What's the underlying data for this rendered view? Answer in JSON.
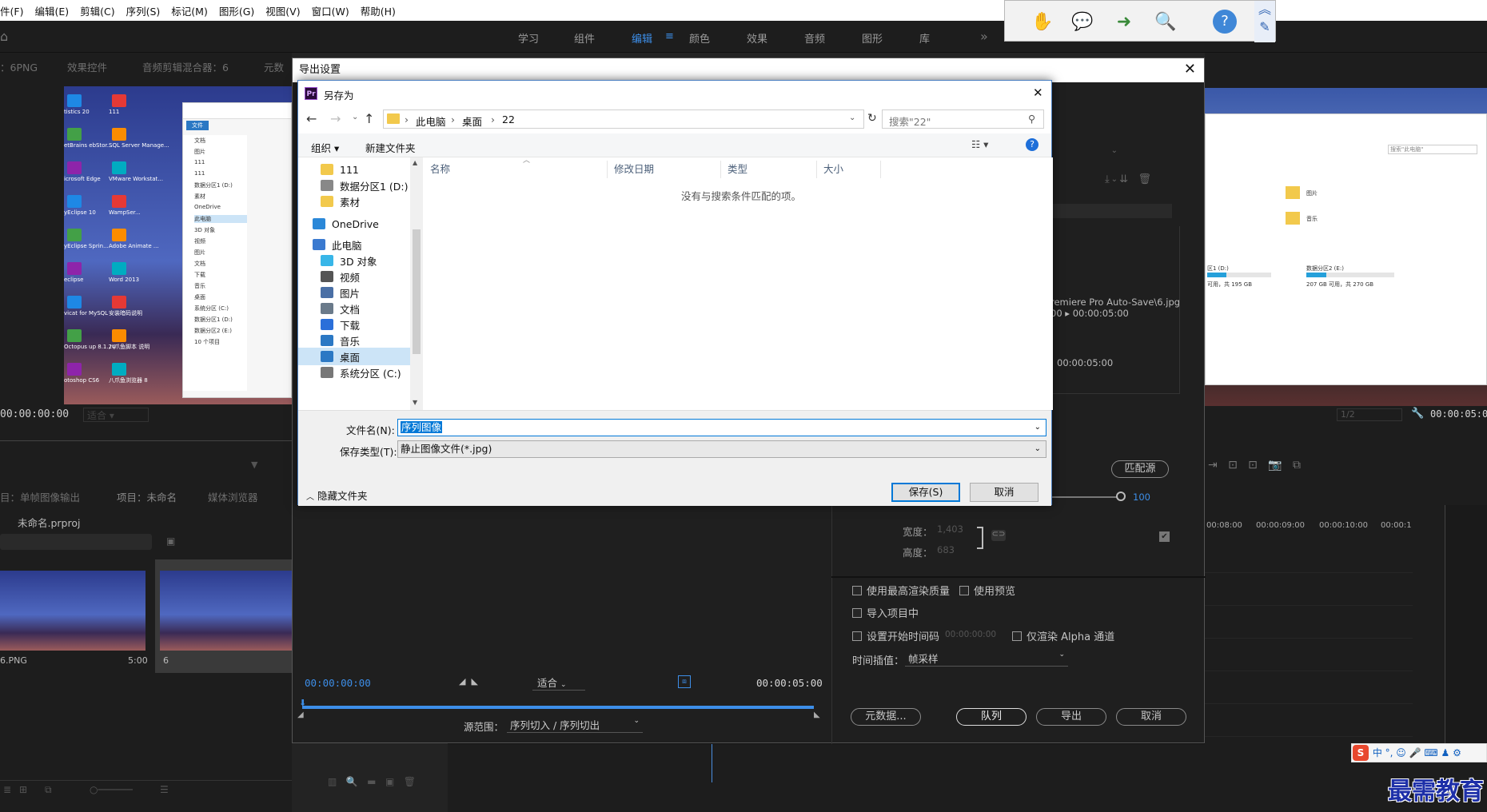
{
  "menubar": [
    "件(F)",
    "编辑(E)",
    "剪辑(C)",
    "序列(S)",
    "标记(M)",
    "图形(G)",
    "视图(V)",
    "窗口(W)",
    "帮助(H)"
  ],
  "workspaces": [
    "学习",
    "组件",
    "编辑",
    "颜色",
    "效果",
    "音频",
    "图形",
    "库"
  ],
  "left_panel": {
    "tabs": [
      "：6PNG",
      "效果控件",
      "音频剪辑混合器：6",
      "元数"
    ],
    "timecode": "00:00:00:00",
    "zoom": "适合",
    "project_tabs": [
      "目：单帧图像输出",
      "项目：未命名",
      "媒体浏览器"
    ],
    "project_file": "未命名.prproj",
    "clips": [
      {
        "name": "6.PNG",
        "dur": "5:00"
      },
      {
        "name": "6",
        "dur": ""
      }
    ]
  },
  "desktop_icons": [
    "tistics 20",
    "111",
    "etBrains ebStor...",
    "SQL Server Manage...",
    "icrosoft Edge",
    "VMware Workstat...",
    "yEclipse 10",
    "WampSer...",
    "yEclipse Sprin...",
    "Adobe Animate ...",
    "eclipse",
    "Word 2013",
    "vicat for MySQL",
    "安装暗码说明",
    "Octopus up 8.1.24",
    "八爪鱼脚本 说明",
    "otoshop CS6",
    "八爪鱼浏览器 8"
  ],
  "mini_explorer": [
    "文档",
    "图片",
    "111",
    "111",
    "数据分区1 (D:)",
    "素材",
    "OneDrive",
    "此电脑",
    "3D 对象",
    "视频",
    "图片",
    "文档",
    "下载",
    "音乐",
    "桌面",
    "系统分区 (C:)",
    "数据分区1 (D:)",
    "数据分区2 (E:)",
    "10 个项目"
  ],
  "export_dialog": {
    "title": "导出设置",
    "close": "✕",
    "timecode_start": "00:00:00:00",
    "fit": "适合",
    "timecode_end": "00:00:05:00",
    "source_range_label": "源范围：",
    "source_range_value": "序列切入 / 序列切出",
    "path": "remiere Pro Auto-Save\\6.jpg",
    "path_time": "00 ▸  00:00:05:00",
    "dur": "00:00:05:00",
    "match_source": "匹配源",
    "opacity_val": "100",
    "width_label": "宽度：",
    "width_val": "1,403",
    "height_label": "高度：",
    "height_val": "683",
    "options": [
      "使用最高渲染质量",
      "使用预览",
      "导入项目中",
      "设置开始时间码",
      "仅渲染 Alpha 通道"
    ],
    "start_tc": "00:00:00:00",
    "interp_label": "时间插值：",
    "interp_value": "帧采样",
    "buttons": [
      "元数据...",
      "队列",
      "导出",
      "取消"
    ]
  },
  "save_as": {
    "title": "另存为",
    "close": "✕",
    "breadcrumb": [
      "此电脑",
      "桌面",
      "22"
    ],
    "search_placeholder": "搜索\"22\"",
    "organize": "组织 ▾",
    "new_folder": "新建文件夹",
    "nav": [
      "111",
      "数据分区1 (D:)",
      "素材",
      "OneDrive",
      "此电脑",
      "3D 对象",
      "视频",
      "图片",
      "文档",
      "下载",
      "音乐",
      "桌面",
      "系统分区 (C:)"
    ],
    "columns": [
      "名称",
      "修改日期",
      "类型",
      "大小"
    ],
    "empty_msg": "没有与搜索条件匹配的项。",
    "filename_label": "文件名(N):",
    "filename_value": "序列图像",
    "filetype_label": "保存类型(T):",
    "filetype_value": "静止图像文件(*.jpg)",
    "hide_folders": "隐藏文件夹",
    "save_btn": "保存(S)",
    "cancel_btn": "取消"
  },
  "right_panel": {
    "timecode": "00:00:05:00",
    "ratio": "1/2",
    "ruler": [
      "00:08:00",
      "00:00:09:00",
      "00:00:10:00",
      "00:00:1"
    ],
    "mini_labels": [
      "图片",
      "音乐",
      "数据分区2 (E:)",
      "207 GB 可用，共 270 GB",
      "区1 (D:)",
      "可用，共 195 GB",
      "搜索\"此电脑\""
    ]
  },
  "watermark": "最需教育",
  "ime": "中 °,"
}
